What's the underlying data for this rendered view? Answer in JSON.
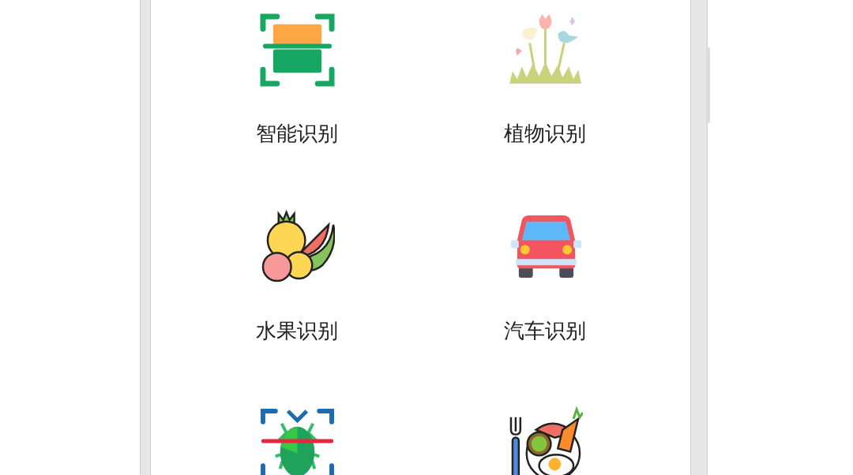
{
  "items": [
    {
      "kind": "scan",
      "label": "智能识别"
    },
    {
      "kind": "plant",
      "label": "植物识别"
    },
    {
      "kind": "fruit",
      "label": "水果识别"
    },
    {
      "kind": "car",
      "label": "汽车识别"
    },
    {
      "kind": "bug"
    },
    {
      "kind": "food"
    }
  ]
}
